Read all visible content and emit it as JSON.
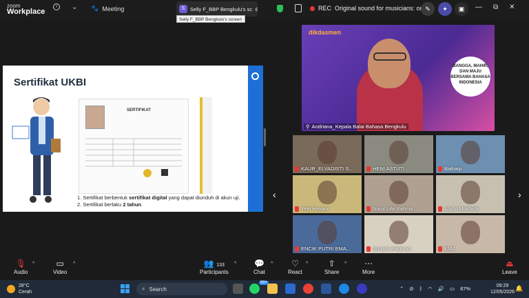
{
  "titlebar": {
    "logo_top": "zoom",
    "logo_bottom": "Workplace",
    "meeting_label": "Meeting",
    "share_tab_initial": "S",
    "share_tab_label": "Selly F_BBP Bengkulu's sc",
    "tooltip": "Selly F_BBP Bengkulu's screen",
    "rec_label": "REC",
    "original_sound": "Original sound for musicians: on",
    "win_controls": [
      "—",
      "⧉",
      "✕"
    ]
  },
  "shared_screen": {
    "title": "Sertifikat UKBI",
    "cert_word": "SERTIFIKAT",
    "line1_pre": "Sertifikat berbentuk ",
    "line1_bold": "sertifikat digital",
    "line1_post": " yang dapat diunduh di akun uji.",
    "line2_pre": "Sertifikat berlaku ",
    "line2_bold": "2 tahun",
    "line2_post": ".",
    "num1": "1.",
    "num2": "2."
  },
  "speaker": {
    "brand_pre": "",
    "brand_main": "dikdasmen",
    "bubble": "BANGGA, MAHIR, DAN MAJU BERSAMA BAHASA INDONESIA",
    "name": "Andriana_Kepala Balai Bahasa Bengkulu"
  },
  "gallery": [
    {
      "name": "KAUR_ELVADISTI S...",
      "color": "#7a6a5a"
    },
    {
      "name": "HENI ASTUTI",
      "color": "#8a8a80"
    },
    {
      "name": "Baihaqi",
      "color": "#6d8fb0"
    },
    {
      "name": "Yetti Hayani",
      "color": "#c9b87a"
    },
    {
      "name": "Nurul Lifa Rahma...",
      "color": "#b0a090"
    },
    {
      "name": "Abdul Mukfadir",
      "color": "#c7c0b0"
    },
    {
      "name": "ENCIK PUTRI EMA...",
      "color": "#4a6a9a"
    },
    {
      "name": "Suharti erlistinah",
      "color": "#d8d0c0"
    },
    {
      "name": "EMA",
      "color": "#c8b8a8"
    }
  ],
  "toolbar": {
    "audio": "Audio",
    "video": "Video",
    "participants": "Participants",
    "participants_count": "133",
    "chat": "Chat",
    "react": "React",
    "share": "Share",
    "more": "More",
    "leave": "Leave"
  },
  "taskbar": {
    "temp": "28°C",
    "weather": "Cerah",
    "search_placeholder": "Search",
    "badge": "99+",
    "battery": "87%",
    "time": "09:29",
    "date": "12/05/2026"
  }
}
